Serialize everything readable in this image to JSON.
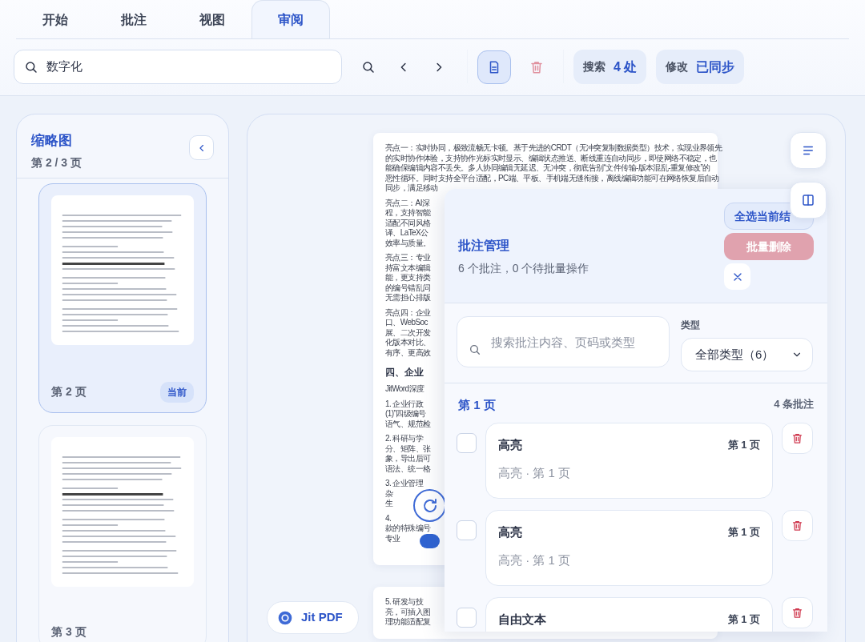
{
  "tabs": [
    {
      "label": "开始",
      "selected": false
    },
    {
      "label": "批注",
      "selected": false
    },
    {
      "label": "视图",
      "selected": false
    },
    {
      "label": "审阅",
      "selected": true
    }
  ],
  "toolbar": {
    "search": {
      "value": "数字化"
    },
    "icon_buttons": [
      {
        "kind": "search",
        "selected": false
      },
      {
        "kind": "previous",
        "selected": false
      },
      {
        "kind": "next",
        "selected": false
      },
      {
        "kind": "document",
        "selected": true
      },
      {
        "kind": "delete",
        "selected": false
      }
    ],
    "status_pills": [
      {
        "label": "搜索",
        "value": "4 处"
      },
      {
        "label": "修改",
        "value": "已同步"
      }
    ]
  },
  "sidebar": {
    "title": "缩略图",
    "subtitle": "第 2 / 3 页",
    "thumbnails": [
      {
        "label": "第 2 页",
        "selected": true,
        "badge": "当前"
      },
      {
        "label": "第 3 页",
        "selected": false
      }
    ]
  },
  "document": {
    "pages": [
      {
        "paragraphs": [
          {
            "kind": "text",
            "lines": [
              "亮点一：实时协同，极致流畅无卡顿。基于先进的CRDT（无冲突复制数据类型）技术，实现业界领先",
              "的实时协作体验，支持协作光标实时显示、编辑状态推送、断线重连自动同步，即使网络不稳定，也",
              "能确保编辑内容不丢失。多人协同编辑无延迟、无冲突，彻底告别“文件传输-版本混乱-重复修改”的",
              "恶性循环。同时支持全平台适配，PC端、平板、手机端无缝衔接，离线编辑功能可在网络恢复后自动",
              "同步，满足移动"
            ]
          },
          {
            "kind": "text",
            "lines": [
              "亮点二：AI深",
              "程，支持智能",
              "适配不同风格",
              "译、LaTeX公",
              "效率与质量。"
            ]
          },
          {
            "kind": "text",
            "lines": [
              "亮点三：专业",
              "持富文本编辑",
              "能，更支持类",
              "的编号错乱问",
              "无需担心排版"
            ]
          },
          {
            "kind": "text",
            "lines": [
              "亮点四：企业",
              "口、WebSoc",
              "展、二次开发",
              "化版本对比、",
              "有序、更高效"
            ]
          },
          {
            "kind": "heading",
            "lines": [
              "四、企业"
            ]
          },
          {
            "kind": "text",
            "lines": [
              "JitWord深度"
            ]
          },
          {
            "kind": "text",
            "lines": [
              "1. 企业行政",
              "(1)”四级编号",
              "语气、规范检"
            ]
          },
          {
            "kind": "text",
            "lines": [
              "2. 科研与学",
              "分、矩阵、张",
              "象，导出后可",
              "语法、统一格"
            ]
          },
          {
            "kind": "text",
            "lines": [
              "3. 企业管理",
              "杂",
              "生"
            ]
          },
          {
            "kind": "text",
            "lines": [
              "4.",
              "款的特殊编号",
              "专业"
            ]
          }
        ]
      },
      {
        "paragraphs": [
          {
            "kind": "text",
            "lines": [
              "5. 研发与技",
              "亮，可插入图",
              "理功能适配复"
            ]
          }
        ]
      }
    ]
  },
  "annotation_panel": {
    "title": "批注管理",
    "summary": "6 个批注，0 个待批量操作",
    "select_all": "全选当前结",
    "bulk_delete": {
      "label": "批量删除",
      "disabled": true
    },
    "search": {
      "placeholder": "搜索批注内容、页码或类型"
    },
    "type_filter": {
      "label": "类型",
      "value": "全部类型（6）"
    },
    "groups": [
      {
        "title": "第 1 页",
        "count": "4 条批注",
        "items": [
          {
            "title": "高亮",
            "page": "第 1 页",
            "meta": "高亮 · 第 1 页",
            "checked": false
          },
          {
            "title": "高亮",
            "page": "第 1 页",
            "meta": "高亮 · 第 1 页",
            "checked": false
          },
          {
            "title": "自由文本",
            "page": "第 1 页",
            "checked": false
          }
        ]
      }
    ]
  },
  "brand": {
    "label": "Jit PDF"
  }
}
